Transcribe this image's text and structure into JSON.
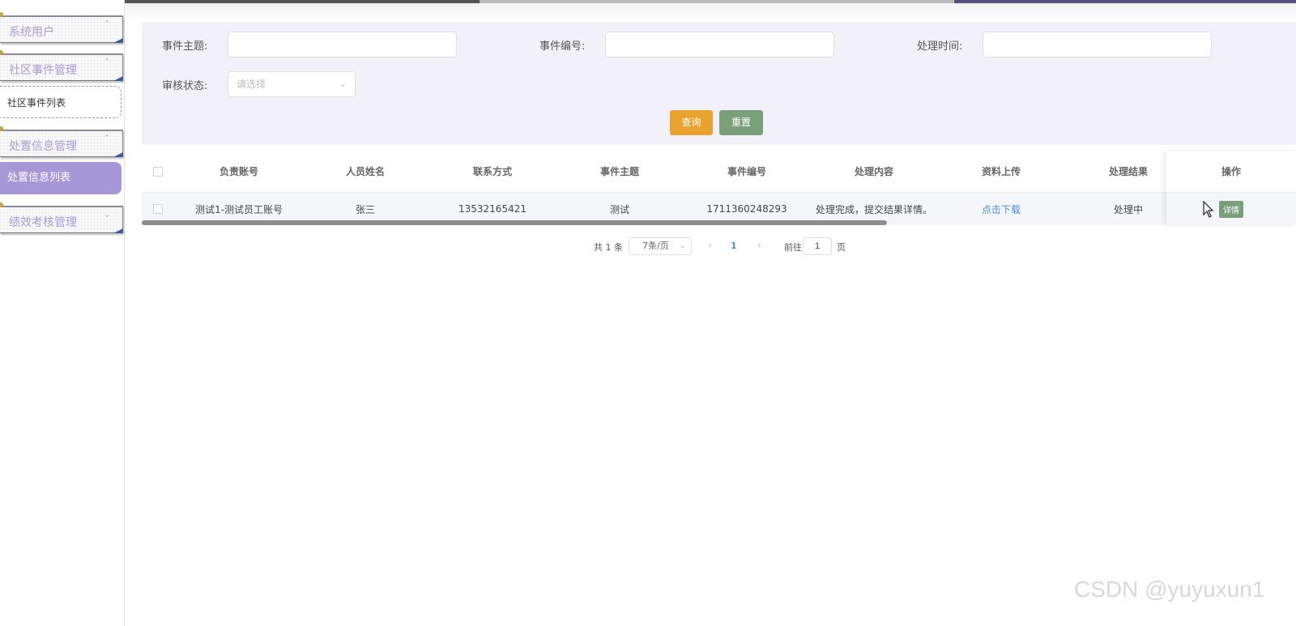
{
  "sidebar": {
    "menus": [
      {
        "label": "系统用户",
        "chevron": "⌃"
      },
      {
        "label": "社区事件管理",
        "chevron": "⌃",
        "sub": "社区事件列表"
      },
      {
        "label": "处置信息管理",
        "chevron": "⌃",
        "sub": "处置信息列表"
      },
      {
        "label": "绩效考核管理",
        "chevron": "⌄"
      }
    ]
  },
  "filter": {
    "subject_label": "事件主题:",
    "subject_value": "",
    "number_label": "事件编号:",
    "number_value": "",
    "time_label": "处理时间:",
    "time_value": "",
    "status_label": "审核状态:",
    "status_placeholder": "请选择",
    "search_label": "查询",
    "reset_label": "重置"
  },
  "table": {
    "headers": [
      "负责账号",
      "人员姓名",
      "联系方式",
      "事件主题",
      "事件编号",
      "处理内容",
      "资料上传",
      "处理结果",
      "操作"
    ],
    "rows": [
      {
        "account": "测试1-测试员工账号",
        "name": "张三",
        "phone": "13532165421",
        "subject": "测试",
        "number": "1711360248293",
        "content": "处理完成，提交结果详情。",
        "upload": "点击下载",
        "result": "处理中",
        "action": "详情"
      }
    ]
  },
  "pagination": {
    "total": "共 1 条",
    "page_size": "7条/页",
    "current": "1",
    "goto_prefix": "前往",
    "goto_value": "1",
    "goto_suffix": "页"
  },
  "watermark": "CSDN @yuyuxun1",
  "colors": {
    "accent_purple": "#a697d6",
    "search_orange": "#eaa22f",
    "reset_green": "#7aa07a",
    "link_blue": "#4a90d9"
  }
}
